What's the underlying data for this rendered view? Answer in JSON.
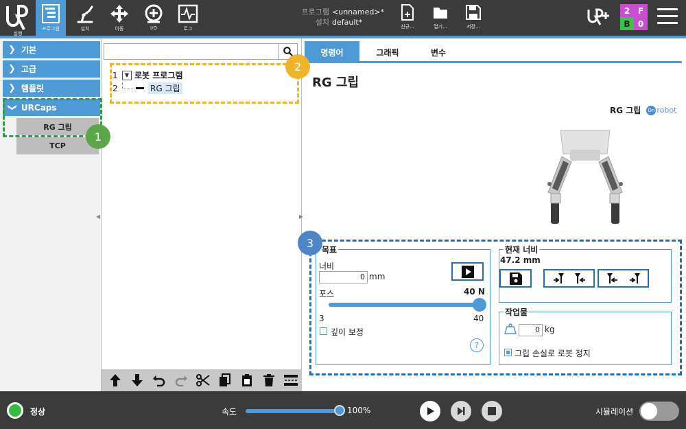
{
  "topbar": {
    "nav": [
      {
        "label": "실행",
        "icon": "run-icon"
      },
      {
        "label": "프로그램",
        "icon": "program-icon"
      },
      {
        "label": "설치",
        "icon": "installation-icon"
      },
      {
        "label": "이동",
        "icon": "move-icon"
      },
      {
        "label": "I/O",
        "icon": "io-icon"
      },
      {
        "label": "로그",
        "icon": "log-icon"
      }
    ],
    "program_key": "프로그램",
    "program_value": "<unnamed>*",
    "install_key": "설치",
    "install_value": "default*",
    "file_buttons": [
      {
        "label": "신규...",
        "icon": "new-file-icon"
      },
      {
        "label": "열기...",
        "icon": "open-folder-icon"
      },
      {
        "label": "저장...",
        "icon": "save-icon"
      }
    ],
    "status": {
      "top_left": "2",
      "top_right": "F",
      "bottom_left": "B",
      "bottom_right": "0"
    }
  },
  "sidebar": {
    "categories": [
      "기본",
      "고급",
      "템플릿",
      "URCaps"
    ],
    "urcaps_items": [
      "RG 그립",
      "TCP"
    ]
  },
  "tree": {
    "search_placeholder": "",
    "rows": [
      {
        "num": "1",
        "label": "로봇 프로그램"
      },
      {
        "num": "2",
        "label": "RG 그립"
      }
    ]
  },
  "tabs": [
    "명령어",
    "그래픽",
    "변수"
  ],
  "node": {
    "title": "RG 그립",
    "brand_label": "RG 그립",
    "brand_logo_text": "robot",
    "brand_logo_mark": "On"
  },
  "target": {
    "title": "목표",
    "width_label": "너비",
    "width_value": "0",
    "width_unit": "mm",
    "force_label": "포스",
    "force_value": "40 N",
    "force_min": "3",
    "force_max": "40",
    "force_fraction": 1.0,
    "depth_comp_label": "깊이 보정",
    "depth_comp_checked": false,
    "help": "?"
  },
  "current_width": {
    "title": "현재 너비",
    "value": "47.2 mm"
  },
  "workpiece": {
    "title": "작업물",
    "mass_value": "0",
    "mass_unit": "kg",
    "stop_on_loss_label": "그립 손실로 로봇 정지",
    "stop_on_loss_checked": true
  },
  "annotations": {
    "c1": "1",
    "c2": "2",
    "c3": "3",
    "colors": {
      "green": "#2e9e44",
      "orange": "#f0b429",
      "blue": "#1f6fb8"
    }
  },
  "bottombar": {
    "status": "정상",
    "speed_label": "속도",
    "speed_value": "100%",
    "speed_fraction": 1.0,
    "sim_label": "시뮬레이션",
    "sim_on": false
  },
  "colors": {
    "accent": "#4d9ad6",
    "topbar": "#3b3b3b",
    "status_ok": "#2fbf3a"
  }
}
